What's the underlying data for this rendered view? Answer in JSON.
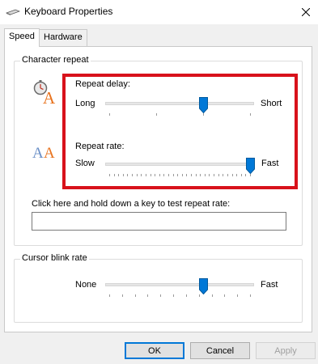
{
  "window": {
    "title": "Keyboard Properties",
    "close_glyph": "✕"
  },
  "tabs": [
    {
      "label": "Speed",
      "active": true
    },
    {
      "label": "Hardware",
      "active": false
    }
  ],
  "character_repeat": {
    "group_label": "Character repeat",
    "repeat_delay": {
      "label": "Repeat delay:",
      "min_label": "Long",
      "max_label": "Short",
      "value": 0.67,
      "tick_count": 4
    },
    "repeat_rate": {
      "label": "Repeat rate:",
      "min_label": "Slow",
      "max_label": "Fast",
      "value": 1.0,
      "tick_count": 32
    },
    "test_label": "Click here and hold down a key to test repeat rate:",
    "test_value": ""
  },
  "cursor_blink": {
    "group_label": "Cursor blink rate",
    "min_label": "None",
    "max_label": "Fast",
    "value": 0.67,
    "tick_count": 12
  },
  "buttons": {
    "ok": "OK",
    "cancel": "Cancel",
    "apply": "Apply"
  },
  "colors": {
    "accent": "#0078d7",
    "highlight": "#d8121b",
    "icon_orange": "#e8731e",
    "icon_blue": "#6a8fc7"
  }
}
